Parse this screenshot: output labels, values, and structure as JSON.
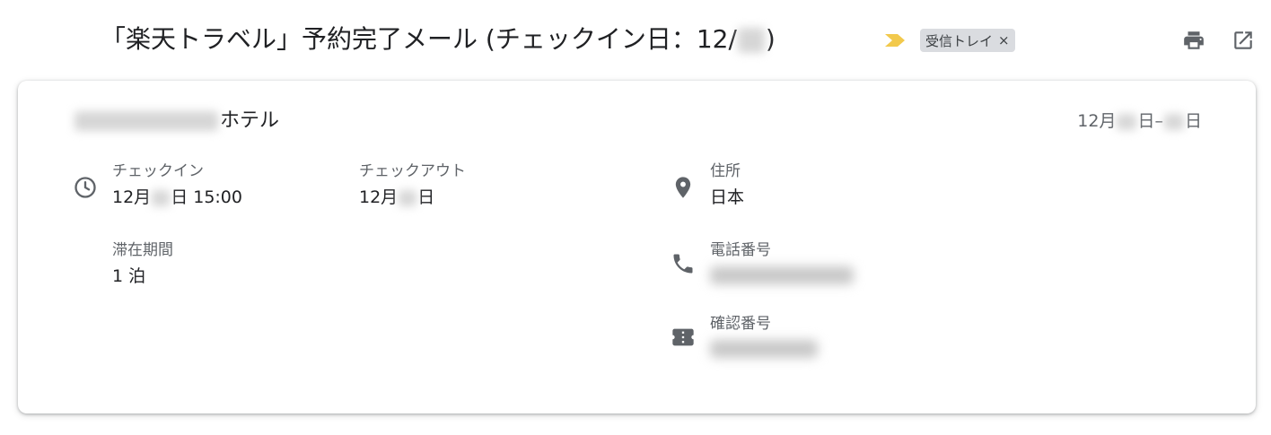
{
  "header": {
    "subject_prefix": "「楽天トラベル」予約完了メール (チェックイン日：12/",
    "subject_suffix": ")",
    "label_chip": "受信トレイ",
    "chip_close": "×",
    "icons": [
      "importance-chevron-icon",
      "print-icon",
      "open-in-new-window-icon"
    ]
  },
  "card": {
    "hotel_suffix": "ホテル",
    "date_month": "12月",
    "date_day": "日",
    "date_dash": "–",
    "date_end_day": "日",
    "checkin": {
      "label": "チェックイン",
      "month": "12月",
      "day_time": "日 15:00"
    },
    "checkout": {
      "label": "チェックアウト",
      "month": "12月",
      "day": "日"
    },
    "stay": {
      "label": "滞在期間",
      "value": "1 泊"
    },
    "address": {
      "label": "住所",
      "value": "日本"
    },
    "phone": {
      "label": "電話番号"
    },
    "confirmation": {
      "label": "確認番号"
    }
  },
  "colors": {
    "accent_chevron": "#f2c94c",
    "icon_gray": "#5f6368",
    "chip_bg": "#dadce0"
  }
}
